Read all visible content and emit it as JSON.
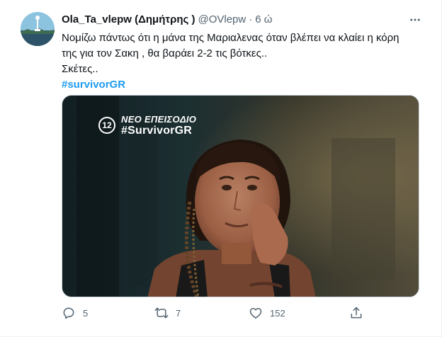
{
  "tweet": {
    "display_name": "Ola_Ta_vlepw (Δημήτρης )",
    "handle": "@OVlepw",
    "separator": "·",
    "time": "6 ώ",
    "text_lines": [
      "Νομίζω πάντως ότι η μάνα της Μαριαλενας όταν βλέπει να κλαίει η κόρη",
      "της για τον Σακη , θα βαράει 2-2 τις βότκες..",
      "Σκέτες.."
    ],
    "hashtag": "#survivorGR"
  },
  "media": {
    "channel_logo": "12",
    "overlay_title": "ΝΕΟ ΕΠΕΙΣΟΔΙΟ",
    "overlay_tag": "#SurvivorGR"
  },
  "actions": {
    "reply_count": "5",
    "retweet_count": "7",
    "like_count": "152"
  },
  "icons": {
    "more": "more-icon",
    "reply": "reply-icon",
    "retweet": "retweet-icon",
    "like": "like-icon",
    "share": "share-icon"
  },
  "colors": {
    "text": "#0f1419",
    "secondary": "#536471",
    "link": "#1d9bf0",
    "border": "#cfd9de"
  }
}
